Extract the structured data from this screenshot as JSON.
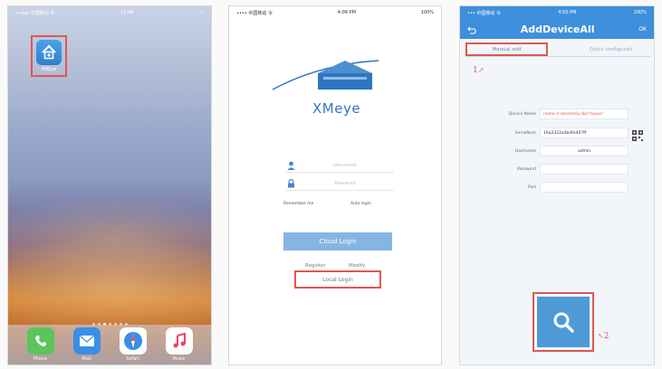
{
  "home": {
    "status_left": "••ooo 中国移动 令",
    "status_time": "11:46",
    "app_name": "XMEye",
    "dock": [
      {
        "name": "Phone",
        "icon": "phone-icon",
        "color": "#5bc45a"
      },
      {
        "name": "Mail",
        "icon": "mail-icon",
        "color": "#3a8ee6"
      },
      {
        "name": "Safari",
        "icon": "safari-icon",
        "color": "#3a8ee6"
      },
      {
        "name": "Music",
        "icon": "music-icon",
        "color": "#ffffff"
      }
    ]
  },
  "login": {
    "status_left": "•••• 中国移动 令",
    "status_time": "4:06 PM",
    "status_right": "100%",
    "logo_text": "XMeye",
    "username_placeholder": "Username",
    "password_placeholder": "Password",
    "remember_me": "Remember me",
    "auto_login": "Auto login",
    "cloud_login": "Cloud Login",
    "register": "Register",
    "modify": "Modify",
    "local_login": "Local Login"
  },
  "add_device": {
    "status_left": "••• 中国移动 令",
    "status_time": "4:50 PM",
    "status_right": "100%",
    "title": "AddDeviceAll",
    "ok": "OK",
    "tab_manual": "Manual add",
    "tab_quick": "Quick configurati",
    "marker_1": "1",
    "marker_2": "2",
    "fields": [
      {
        "label": "Device Name",
        "value": "name it randomly,like\"house\"",
        "color": "#e0584e"
      },
      {
        "label": "SerialNum",
        "value": "16a2322a4b4fe407ff",
        "color": "#333333"
      },
      {
        "label": "Username",
        "value": "admin",
        "color": "#333333"
      },
      {
        "label": "Password",
        "value": "",
        "color": "#bbbbbb"
      },
      {
        "label": "Port",
        "value": "",
        "color": "#bbbbbb"
      }
    ],
    "accent": "#3e90dc"
  }
}
